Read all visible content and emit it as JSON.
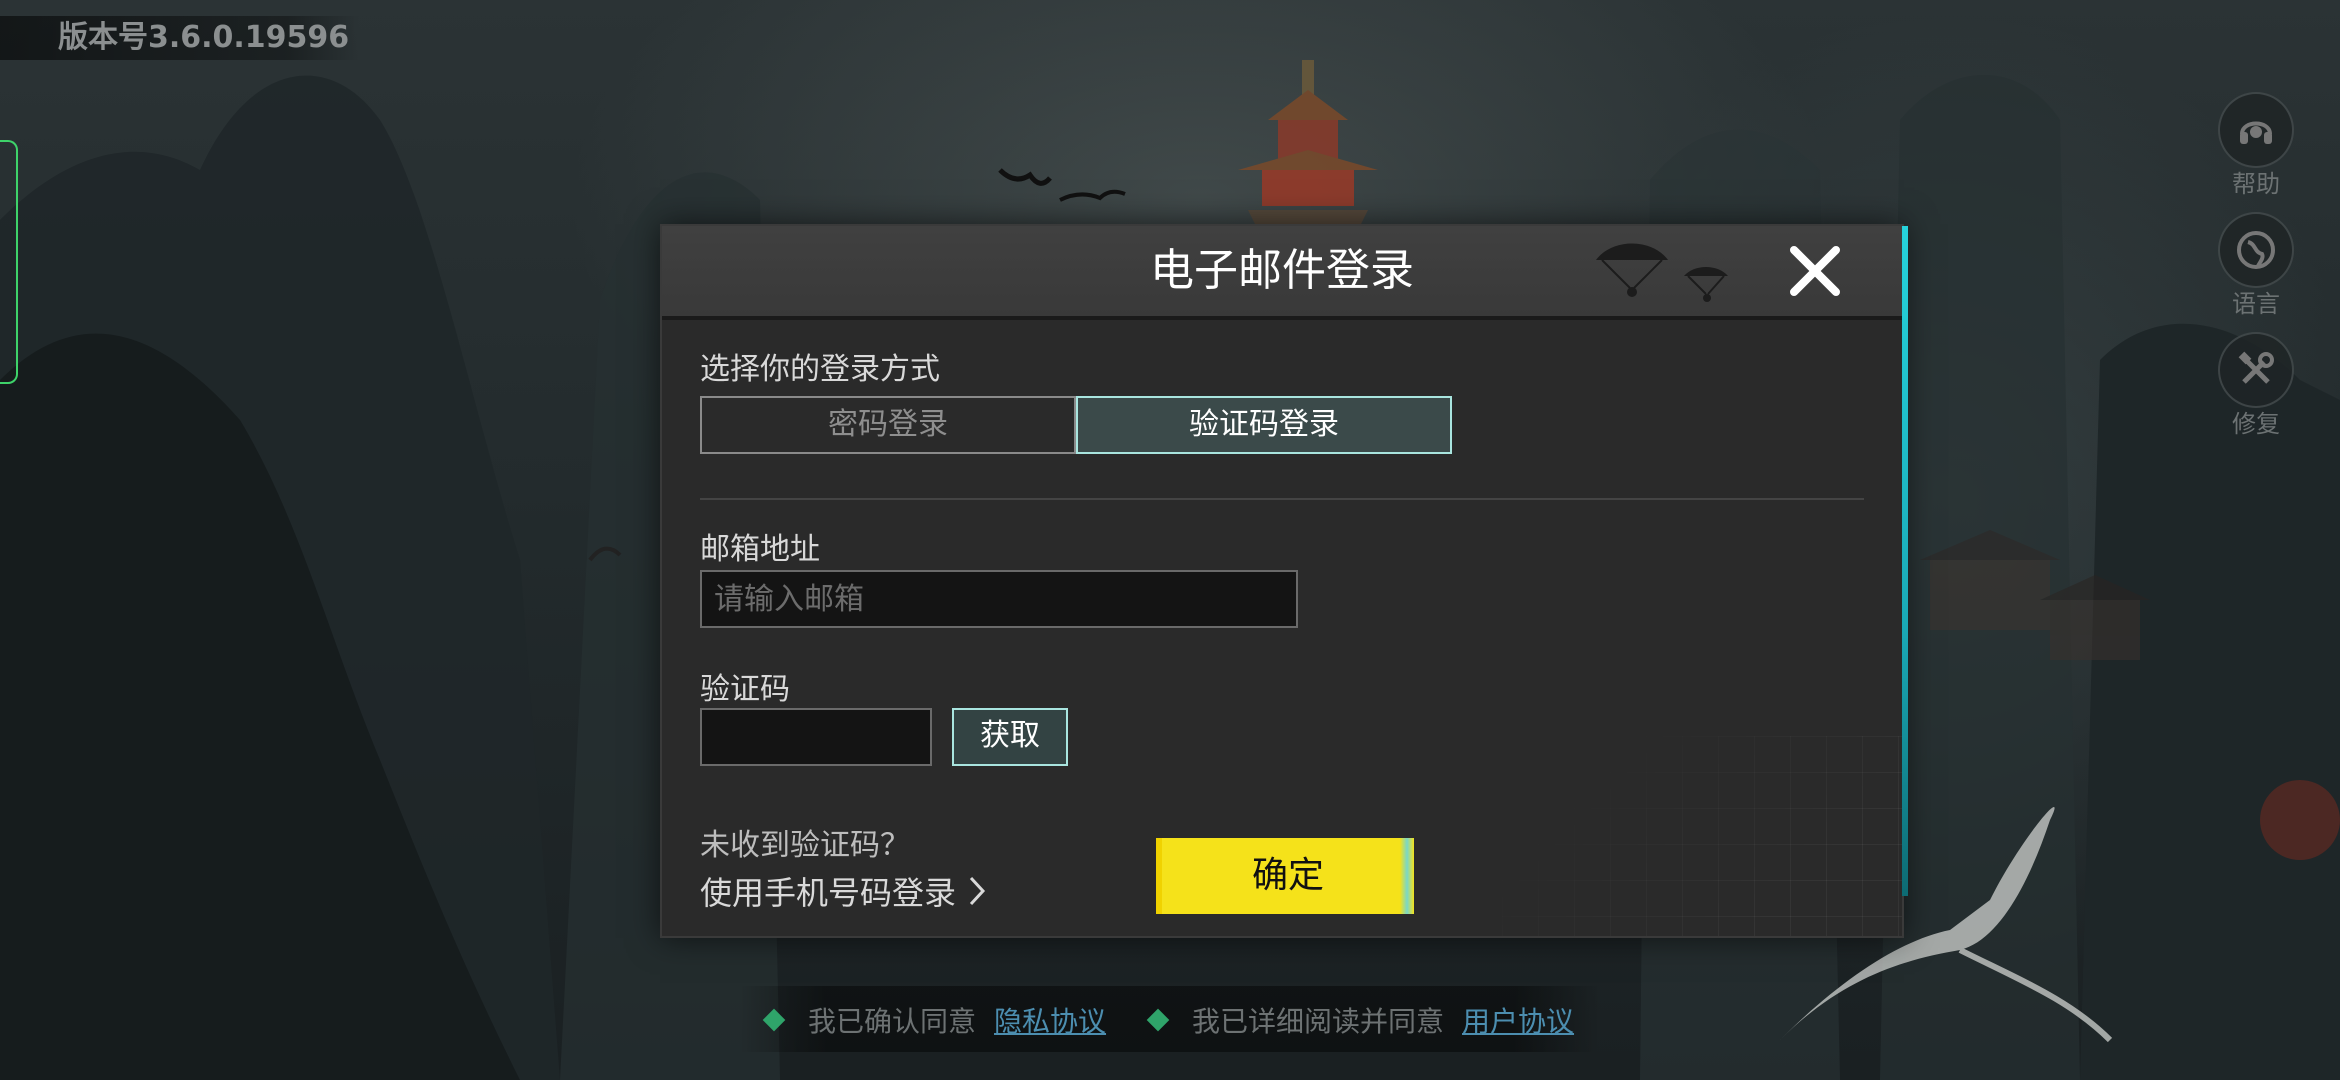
{
  "version_label": "版本号3.6.0.19596",
  "side_buttons": [
    {
      "label": "帮助",
      "icon": "headset-icon"
    },
    {
      "label": "语言",
      "icon": "globe-icon"
    },
    {
      "label": "修复",
      "icon": "tools-icon"
    }
  ],
  "dialog": {
    "title": "电子邮件登录",
    "close_icon": "close-icon",
    "method_label": "选择你的登录方式",
    "tabs": [
      {
        "label": "密码登录",
        "selected": false
      },
      {
        "label": "验证码登录",
        "selected": true
      }
    ],
    "email": {
      "label": "邮箱地址",
      "placeholder": "请输入邮箱",
      "value": ""
    },
    "code": {
      "label": "验证码",
      "value": "",
      "get_button": "获取"
    },
    "not_received": "未收到验证码？",
    "phone_login_link": "使用手机号码登录",
    "confirm_button": "确定"
  },
  "agreements": [
    {
      "text": "我已确认同意",
      "link": "隐私协议"
    },
    {
      "text": "我已详细阅读并同意",
      "link": "用户协议"
    }
  ],
  "colors": {
    "accent_yellow": "#f5e21a",
    "accent_teal": "#a9e5df",
    "dialog_bg": "#2a2a2a",
    "agree_green": "#2fa46a",
    "link_blue": "#4c8eb0"
  }
}
